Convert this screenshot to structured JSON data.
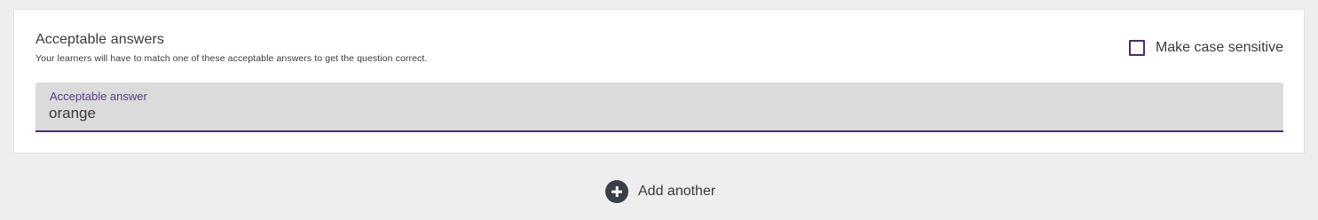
{
  "card": {
    "title": "Acceptable answers",
    "subtitle": "Your learners will have to match one of these acceptable answers to get the question correct.",
    "case_sensitive": {
      "label": "Make case sensitive",
      "checked": false
    },
    "answer_field": {
      "label": "Acceptable answer",
      "value": "orange"
    }
  },
  "add_another": {
    "label": "Add another",
    "icon": "plus-circle-icon"
  },
  "colors": {
    "accent": "#4b2b6e",
    "field_label": "#5a3c86",
    "field_background": "#dbdbdb",
    "page_background": "#eeeeee",
    "icon_background": "#3a3f46"
  }
}
